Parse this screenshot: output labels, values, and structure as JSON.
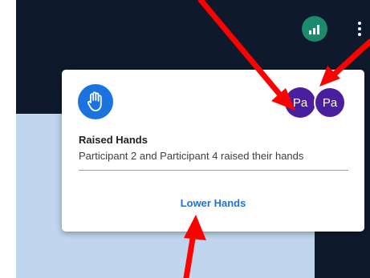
{
  "notification": {
    "title": "Raised Hands",
    "message": "Participant 2 and Participant 4 raised their hands",
    "action_label": "Lower Hands",
    "avatars": [
      "Pa",
      "Pa"
    ]
  },
  "colors": {
    "accent": "#1b73e0",
    "avatar": "#4a1f9f",
    "signal": "#1d8a6e",
    "background": "#0e1a2c",
    "panel": "#bfd6ee",
    "annotation_arrow": "#ff0000"
  },
  "icons": {
    "notification_icon": "raised-hand-icon",
    "network_indicator": "signal-bars-icon",
    "menu": "more-vertical-icon"
  }
}
